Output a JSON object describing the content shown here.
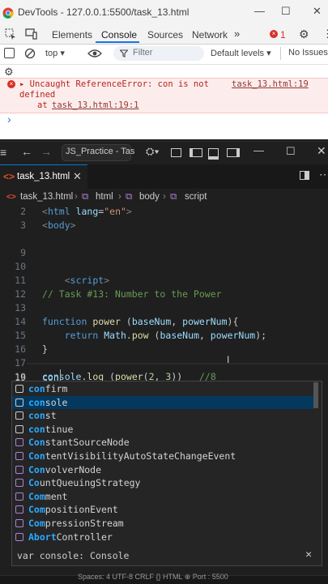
{
  "devtools": {
    "window_title": "DevTools - 127.0.0.1:5500/task_13.html",
    "tabs": [
      "Elements",
      "Console",
      "Sources",
      "Network"
    ],
    "error_count": "1",
    "context": "top",
    "filter_placeholder": "Filter",
    "levels": "Default levels ▾",
    "issues": "No Issues",
    "error": {
      "message_line1": "▸ Uncaught ReferenceError: con is not",
      "message_line2": "defined",
      "link": "task_13.html:19",
      "at_prefix": "at ",
      "at_link": "task_13.html:19:1"
    },
    "prompt": "›"
  },
  "vscode": {
    "search_text": "JS_Practice - Tas",
    "active_tab": "task_13.html",
    "breadcrumb": [
      "task_13.html",
      "html",
      "body",
      "script"
    ],
    "lines": [
      {
        "n": "2",
        "text": "<html lang=\"en\">"
      },
      {
        "n": "3",
        "text": "<body>"
      },
      {
        "n": "9",
        "text": ""
      },
      {
        "n": "10",
        "text": ""
      },
      {
        "n": "11",
        "text": "    <script>"
      },
      {
        "n": "12",
        "text": "// Task #13: Number to the Power"
      },
      {
        "n": "13",
        "text": ""
      },
      {
        "n": "14",
        "text": "function power (baseNum, powerNum){"
      },
      {
        "n": "15",
        "text": "    return Math.pow (baseNum, powerNum);"
      },
      {
        "n": "16",
        "text": "}"
      },
      {
        "n": "17",
        "text": ""
      },
      {
        "n": "18",
        "text": "console.log (power(2, 3))   //8"
      },
      {
        "n": "19",
        "text": "con"
      }
    ],
    "suggestions": [
      {
        "hl": "con",
        "rest": "firm"
      },
      {
        "hl": "con",
        "rest": "sole"
      },
      {
        "hl": "con",
        "rest": "st"
      },
      {
        "hl": "con",
        "rest": "tinue"
      },
      {
        "hl": "Con",
        "rest": "stantSourceNode"
      },
      {
        "hl": "Con",
        "rest": "tentVisibilityAutoStateChangeEvent"
      },
      {
        "hl": "Con",
        "rest": "volverNode"
      },
      {
        "hl": "Co",
        "rest": "untQueuingStrategy"
      },
      {
        "hl": "Com",
        "rest": "ment"
      },
      {
        "hl": "Com",
        "rest": "positionEvent"
      },
      {
        "hl": "Com",
        "rest": "pressionStream"
      },
      {
        "hl": "Abort",
        "rest": "Controller"
      }
    ],
    "detail": "var console: Console",
    "close": "×",
    "status": "Spaces: 4   UTF-8   CRLF   {} HTML   ⊕ Port : 5500"
  }
}
